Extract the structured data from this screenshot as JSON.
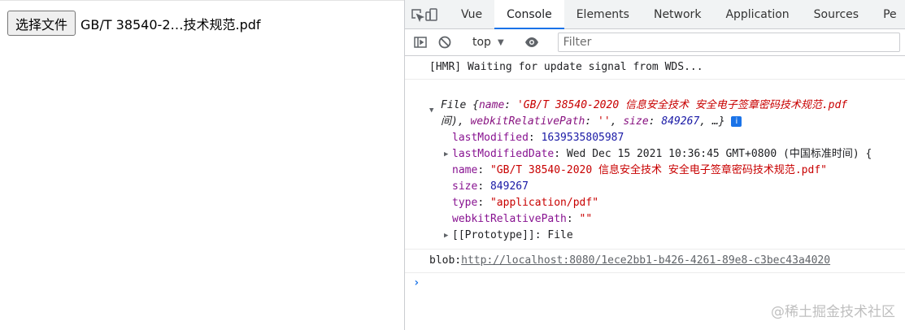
{
  "page": {
    "choose_button": "选择文件",
    "file_name": "GB/T 38540-2…技术规范.pdf"
  },
  "devtools": {
    "tabs": [
      {
        "label": "Vue"
      },
      {
        "label": "Console",
        "active": true
      },
      {
        "label": "Elements"
      },
      {
        "label": "Network"
      },
      {
        "label": "Application"
      },
      {
        "label": "Sources"
      },
      {
        "label": "Pe"
      }
    ],
    "toolbar": {
      "context": "top",
      "filter_placeholder": "Filter"
    },
    "console": {
      "hmr": "[HMR] Waiting for update signal from WDS...",
      "obj_line1_type": "File {",
      "obj_line1_key": "name",
      "obj_line1_val": "'GB/T 38540-2020 信息安全技术 安全电子签章密码技术规范.pdf",
      "obj_line2_a": "间), ",
      "obj_line2_key1": "webkitRelativePath",
      "obj_line2_val1": "''",
      "obj_line2_key2": "size",
      "obj_line2_val2": "849267",
      "obj_line2_end": ", …}",
      "props": [
        {
          "key": "lastModified",
          "sep": ": ",
          "val": "1639535805987",
          "cls": "num"
        },
        {
          "key": "lastModifiedDate",
          "sep": ": ",
          "val": "Wed Dec 15 2021 10:36:45 GMT+0800 (中国标准时间) {",
          "cls": "plain",
          "expandable": true
        },
        {
          "key": "name",
          "sep": ": ",
          "val": "\"GB/T 38540-2020 信息安全技术 安全电子签章密码技术规范.pdf\"",
          "cls": "str"
        },
        {
          "key": "size",
          "sep": ": ",
          "val": "849267",
          "cls": "num"
        },
        {
          "key": "type",
          "sep": ": ",
          "val": "\"application/pdf\"",
          "cls": "str"
        },
        {
          "key": "webkitRelativePath",
          "sep": ": ",
          "val": "\"\"",
          "cls": "str"
        },
        {
          "key": "[[Prototype]]",
          "sep": ": ",
          "val": "File",
          "cls": "plain",
          "expandable": true
        }
      ],
      "blob_prefix": "blob:",
      "blob_url": "http://localhost:8080/1ece2bb1-b426-4261-89e8-c3bec43a4020"
    }
  },
  "watermark": "@稀土掘金技术社区",
  "icons": [
    "inspect-icon",
    "device-toggle-icon",
    "sidebar-toggle-icon",
    "clear-console-icon",
    "eye-icon",
    "info-icon",
    "chevron-right-icon"
  ]
}
